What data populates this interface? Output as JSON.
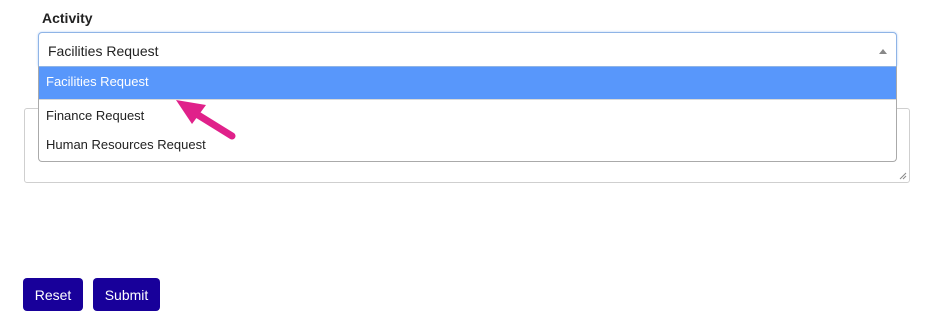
{
  "form": {
    "activity_label": "Activity",
    "activity_select": {
      "selected_value": "Facilities Request",
      "options": [
        {
          "label": "Facilities Request",
          "highlighted": true
        },
        {
          "label": "Finance Request",
          "highlighted": false
        },
        {
          "label": "Human Resources Request",
          "highlighted": false
        }
      ]
    },
    "buttons": {
      "reset_label": "Reset",
      "submit_label": "Submit"
    }
  },
  "colors": {
    "button_bg": "#18009a",
    "option_highlight": "#5897fb",
    "annotation_arrow": "#e0218a"
  },
  "icons": {
    "select_arrow": "triangle-up-icon",
    "textarea_grip": "resize-grip-icon",
    "annotation": "pointer-arrow-icon"
  }
}
